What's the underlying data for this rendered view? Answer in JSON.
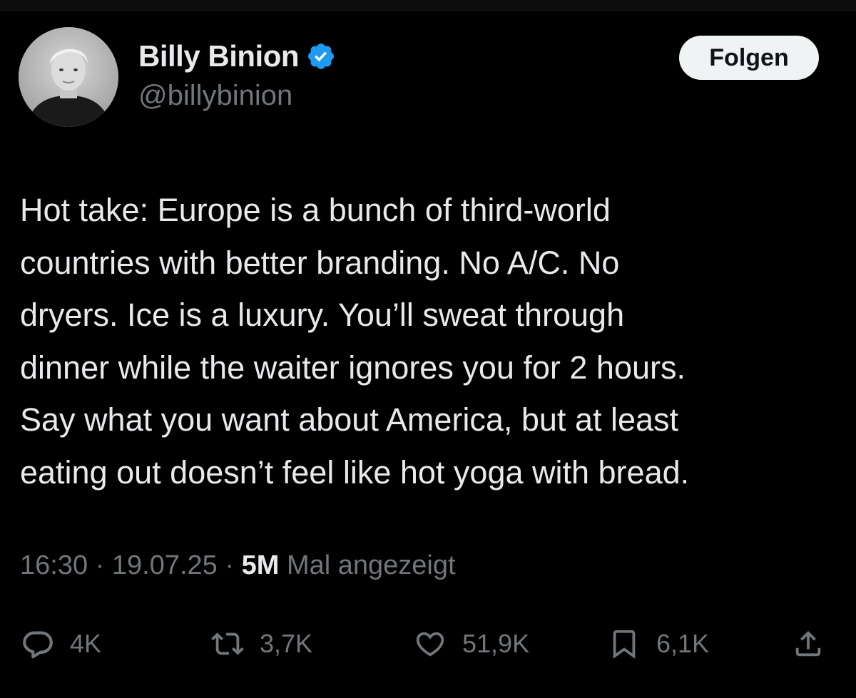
{
  "author": {
    "display_name": "Billy Binion",
    "handle": "@billybinion",
    "verified": true,
    "avatar": "profile-photo"
  },
  "follow_button": {
    "label": "Folgen"
  },
  "tweet": {
    "lines": [
      "Hot take: Europe is a bunch of third-world",
      "countries with better branding. No A/C. No",
      "dryers. Ice is a luxury. You’ll sweat through",
      "dinner while the waiter ignores you for 2 hours.",
      "Say what you want about America, but at least",
      "eating out doesn’t feel like hot yoga with bread."
    ]
  },
  "meta": {
    "time": "16:30",
    "separator": "·",
    "date": "19.07.25",
    "views_count": "5M",
    "views_label": "Mal angezeigt"
  },
  "actions": {
    "replies": {
      "icon": "reply-icon",
      "count": "4K"
    },
    "reposts": {
      "icon": "repost-icon",
      "count": "3,7K"
    },
    "likes": {
      "icon": "heart-icon",
      "count": "51,9K"
    },
    "bookmarks": {
      "icon": "bookmark-icon",
      "count": "6,1K"
    },
    "share": {
      "icon": "share-icon"
    }
  },
  "colors": {
    "background": "#000000",
    "primary_text": "#e7e9ea",
    "secondary_text": "#71767b",
    "verified_blue": "#1d9bf0",
    "button_bg": "#eff3f4"
  }
}
